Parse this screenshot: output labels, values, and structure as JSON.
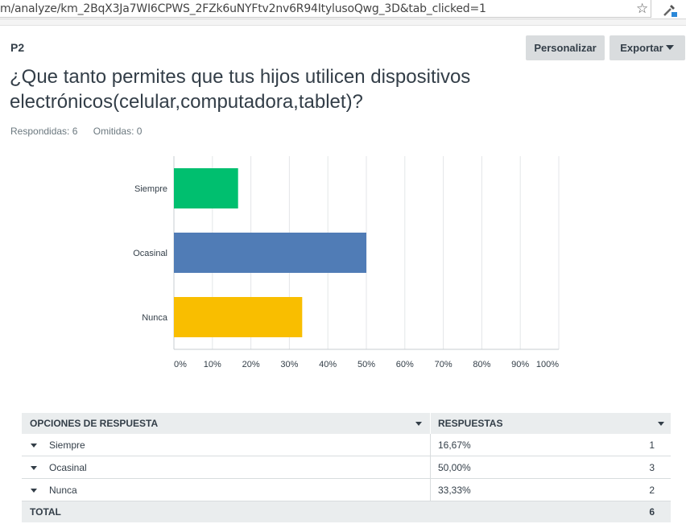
{
  "browser": {
    "url": "m/analyze/km_2BqX3Ja7WI6CPWS_2FZk6uNYFtv2nv6R94ItylusoQwg_3D&tab_clicked=1",
    "bookmark_icon": "star-icon",
    "extension_icon": "eyedropper-icon"
  },
  "question": {
    "number": "P2",
    "text_line1": "¿Que tanto permites que tus hijos utilicen dispositivos",
    "text_line2": "electrónicos(celular,computadora,tablet)?",
    "answered": "Respondidas: 6",
    "skipped": "Omitidas: 0"
  },
  "toolbar": {
    "customize_label": "Personalizar",
    "export_label": "Exportar"
  },
  "chart_data": {
    "type": "bar",
    "orientation": "horizontal",
    "categories": [
      "Siempre",
      "Ocasinal",
      "Nunca"
    ],
    "values": [
      16.67,
      50.0,
      33.33
    ],
    "colors": [
      "#00bf6f",
      "#507cb6",
      "#f9be00"
    ],
    "xlim": [
      0,
      100
    ],
    "x_ticks": [
      "0%",
      "10%",
      "20%",
      "30%",
      "40%",
      "50%",
      "60%",
      "70%",
      "80%",
      "90%",
      "100%"
    ],
    "grid": true
  },
  "table": {
    "headers": [
      "OPCIONES DE RESPUESTA",
      "RESPUESTAS"
    ],
    "rows": [
      {
        "option": "Siempre",
        "percent": "16,67%",
        "count": "1"
      },
      {
        "option": "Ocasinal",
        "percent": "50,00%",
        "count": "3"
      },
      {
        "option": "Nunca",
        "percent": "33,33%",
        "count": "2"
      }
    ],
    "total_label": "TOTAL",
    "total_count": "6"
  }
}
